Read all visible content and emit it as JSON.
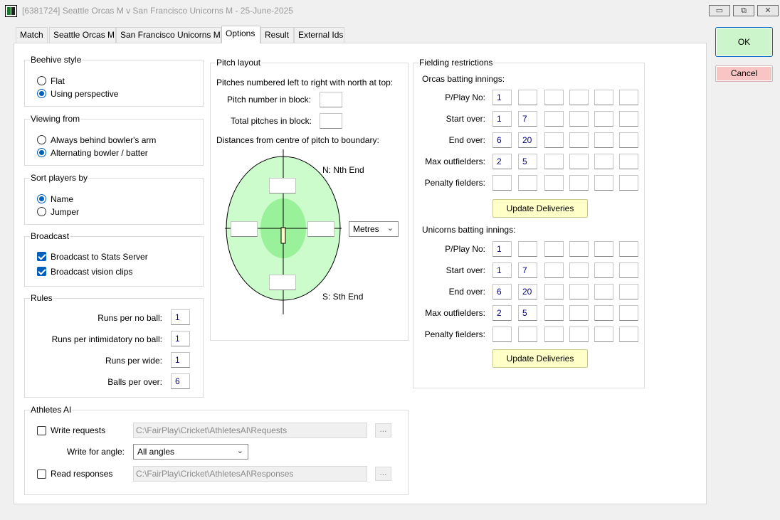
{
  "window": {
    "title": "[6381724] Seattle Orcas M v San Francisco Unicorns M - 25-June-2025",
    "minimize_glyph": "▭",
    "maximize_glyph": "⧉",
    "close_glyph": "✕"
  },
  "tabs": [
    "Match",
    "Seattle Orcas M",
    "San Francisco Unicorns M",
    "Options",
    "Result",
    "External Ids"
  ],
  "active_tab": "Options",
  "beehive": {
    "title": "Beehive style",
    "options": [
      "Flat",
      "Using perspective"
    ],
    "selected": "Using perspective"
  },
  "viewing": {
    "title": "Viewing from",
    "options": [
      "Always behind bowler's arm",
      "Alternating bowler / batter"
    ],
    "selected": "Alternating bowler / batter"
  },
  "sort": {
    "title": "Sort players by",
    "options": [
      "Name",
      "Jumper"
    ],
    "selected": "Name"
  },
  "broadcast": {
    "title": "Broadcast",
    "items": [
      {
        "label": "Broadcast to Stats Server",
        "checked": true
      },
      {
        "label": "Broadcast vision clips",
        "checked": true
      }
    ]
  },
  "rules": {
    "title": "Rules",
    "items": [
      {
        "label": "Runs per no ball:",
        "value": "1"
      },
      {
        "label": "Runs per intimidatory no ball:",
        "value": "1"
      },
      {
        "label": "Runs per wide:",
        "value": "1"
      },
      {
        "label": "Balls per over:",
        "value": "6"
      }
    ]
  },
  "athletes": {
    "title": "Athletes AI",
    "write_label": "Write requests",
    "write_checked": false,
    "write_path": "C:\\FairPlay\\Cricket\\AthletesAI\\Requests",
    "angle_label": "Write for angle:",
    "angle_value": "All angles",
    "read_label": "Read responses",
    "read_checked": false,
    "read_path": "C:\\FairPlay\\Cricket\\AthletesAI\\Responses",
    "browse_label": "..."
  },
  "pitch": {
    "title": "Pitch layout",
    "numbered_label": "Pitches numbered left to right with north at top:",
    "number_in_block_label": "Pitch number in block:",
    "number_in_block_value": "",
    "total_label": "Total pitches in block:",
    "total_value": "",
    "distances_label": "Distances from centre of pitch to boundary:",
    "north_label": "N: Nth End",
    "south_label": "S: Sth End",
    "unit_value": "Metres",
    "north_value": "",
    "south_value": "",
    "west_value": "",
    "east_value": ""
  },
  "fielding": {
    "title": "Fielding restrictions",
    "row_labels": [
      "P/Play No:",
      "Start over:",
      "End over:",
      "Max outfielders:",
      "Penalty fielders:"
    ],
    "update_label": "Update Deliveries",
    "orcas": {
      "title": "Orcas batting innings:",
      "rows": [
        [
          "1",
          "",
          "",
          "",
          "",
          ""
        ],
        [
          "1",
          "7",
          "",
          "",
          "",
          ""
        ],
        [
          "6",
          "20",
          "",
          "",
          "",
          ""
        ],
        [
          "2",
          "5",
          "",
          "",
          "",
          ""
        ],
        [
          "",
          "",
          "",
          "",
          "",
          ""
        ]
      ]
    },
    "unicorns": {
      "title": "Unicorns batting innings:",
      "rows": [
        [
          "1",
          "",
          "",
          "",
          "",
          ""
        ],
        [
          "1",
          "7",
          "",
          "",
          "",
          ""
        ],
        [
          "6",
          "20",
          "",
          "",
          "",
          ""
        ],
        [
          "2",
          "5",
          "",
          "",
          "",
          ""
        ],
        [
          "",
          "",
          "",
          "",
          "",
          ""
        ]
      ]
    }
  },
  "actions": {
    "ok": "OK",
    "cancel": "Cancel"
  },
  "colors": {
    "accent": "#005fb8",
    "field_outer": "#ccfccc",
    "field_inner": "#99f199",
    "ok_bg": "#ccf5cc",
    "cancel_bg": "#f8c4c4",
    "update_bg": "#ffffc8"
  }
}
